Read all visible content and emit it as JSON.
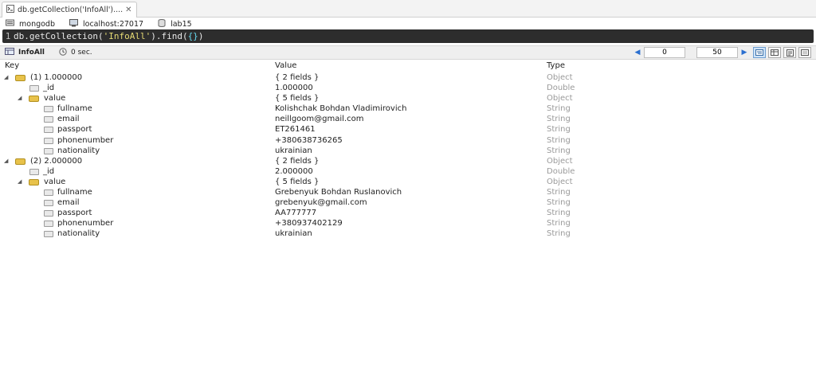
{
  "tab": {
    "title": "db.getCollection('InfoAll')....",
    "close": "✕"
  },
  "info": {
    "database": "mongodb",
    "server": "localhost:27017",
    "collection": "lab15"
  },
  "query": {
    "line": "1",
    "prefix": "db.getCollection(",
    "string": "'InfoAll'",
    "middle": ").find(",
    "braces": "{}",
    "suffix": ")"
  },
  "results_toolbar": {
    "collection": "InfoAll",
    "time": "0 sec.",
    "page_start": "0",
    "page_size": "50"
  },
  "columns": {
    "key": "Key",
    "value": "Value",
    "type": "Type"
  },
  "rows": [
    {
      "key": "(1) 1.000000",
      "value": "{ 2 fields }",
      "type": "Object"
    },
    {
      "key": "_id",
      "value": "1.000000",
      "type": "Double"
    },
    {
      "key": "value",
      "value": "{ 5 fields }",
      "type": "Object"
    },
    {
      "key": "fullname",
      "value": "Kolishchak Bohdan Vladimirovich",
      "type": "String"
    },
    {
      "key": "email",
      "value": "neillgoom@gmail.com",
      "type": "String"
    },
    {
      "key": "passport",
      "value": "ET261461",
      "type": "String"
    },
    {
      "key": "phonenumber",
      "value": "+380638736265",
      "type": "String"
    },
    {
      "key": "nationality",
      "value": "ukrainian",
      "type": "String"
    },
    {
      "key": "(2) 2.000000",
      "value": "{ 2 fields }",
      "type": "Object"
    },
    {
      "key": "_id",
      "value": "2.000000",
      "type": "Double"
    },
    {
      "key": "value",
      "value": "{ 5 fields }",
      "type": "Object"
    },
    {
      "key": "fullname",
      "value": "Grebenyuk Bohdan Ruslanovich",
      "type": "String"
    },
    {
      "key": "email",
      "value": "grebenyuk@gmail.com",
      "type": "String"
    },
    {
      "key": "passport",
      "value": "AA777777",
      "type": "String"
    },
    {
      "key": "phonenumber",
      "value": "+380937402129",
      "type": "String"
    },
    {
      "key": "nationality",
      "value": "ukrainian",
      "type": "String"
    }
  ],
  "icons": {
    "tab": "shell-icon",
    "database": "database-icon",
    "server": "server-icon",
    "collection": "collection-icon",
    "doc": "document-icon",
    "field": "field-icon",
    "expanded": "expanded-arrow-icon"
  },
  "colors": {
    "query_bg": "#2d2d2d",
    "string": "#e6db74",
    "brace": "#66d9ef",
    "type_text": "#9a9a9a",
    "doc_icon": "#e8c24a",
    "accent": "#2a6fd0"
  }
}
